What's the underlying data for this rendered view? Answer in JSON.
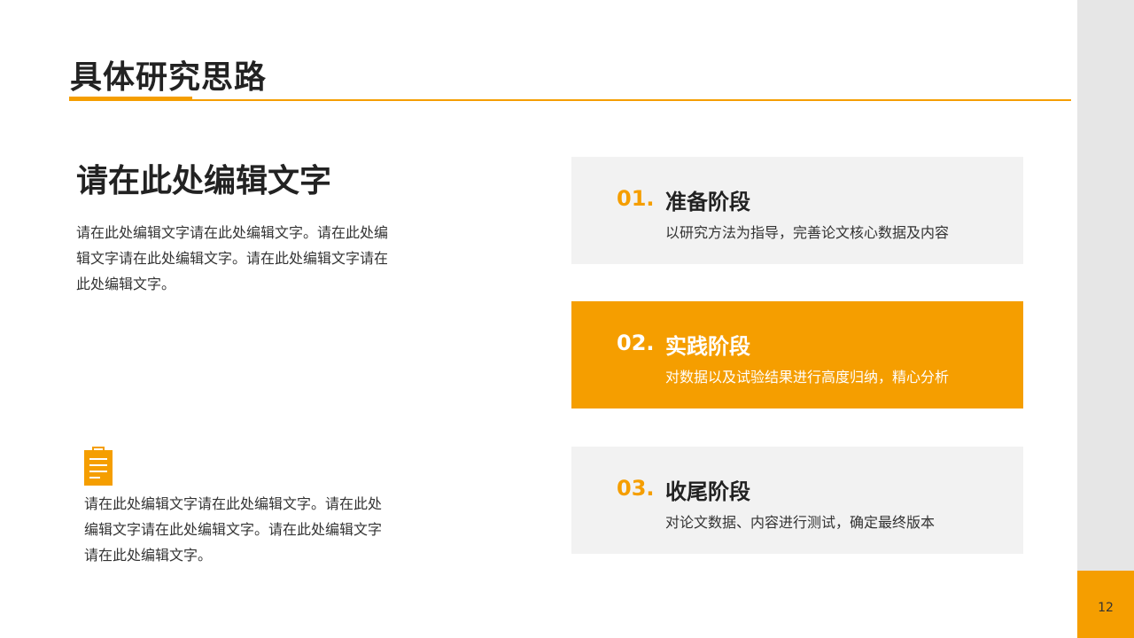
{
  "slide": {
    "title": "具体研究思路",
    "page_number": "12"
  },
  "left": {
    "heading": "请在此处编辑文字",
    "paragraph": "请在此处编辑文字请在此处编辑文字。请在此处编辑文字请在此处编辑文字。请在此处编辑文字请在此处编辑文字。",
    "bottom_paragraph": "请在此处编辑文字请在此处编辑文字。请在此处编辑文字请在此处编辑文字。请在此处编辑文字请在此处编辑文字。",
    "icon": "clipboard-icon"
  },
  "stages": [
    {
      "num": "01.",
      "title": "准备阶段",
      "desc": "以研究方法为指导，完善论文核心数据及内容",
      "highlighted": false
    },
    {
      "num": "02.",
      "title": "实践阶段",
      "desc": "对数据以及试验结果进行高度归纳，精心分析",
      "highlighted": true
    },
    {
      "num": "03.",
      "title": "收尾阶段",
      "desc": "对论文数据、内容进行测试，确定最终版本",
      "highlighted": false
    }
  ],
  "colors": {
    "accent": "#f59e00",
    "card_bg": "#f2f2f2",
    "sidebar": "#e6e6e6",
    "text_dark": "#222222"
  }
}
